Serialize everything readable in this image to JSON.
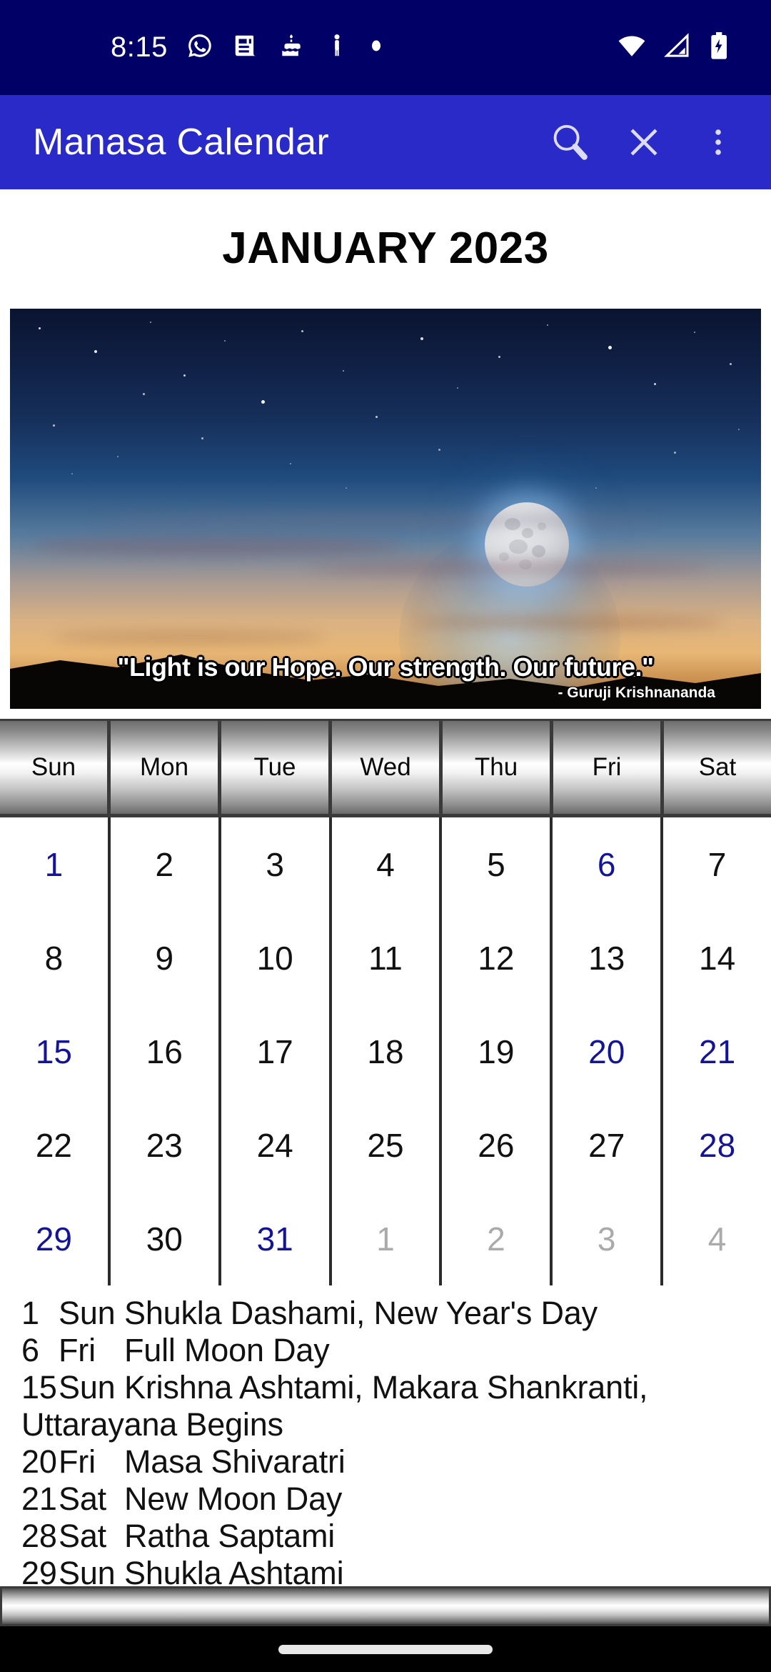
{
  "status_bar": {
    "time": "8:15",
    "left_icons": [
      "whatsapp-icon",
      "news-icon",
      "birthday-cake-icon",
      "person-icon",
      "dot-icon"
    ],
    "right_icons": [
      "wifi-icon",
      "cellular-signal-icon",
      "battery-charging-icon"
    ],
    "background_color": "#000066"
  },
  "app_bar": {
    "title": "Manasa Calendar",
    "background_color": "#2A2AC8",
    "actions": [
      {
        "name": "search-icon",
        "label": "Search"
      },
      {
        "name": "close-icon",
        "label": "Close"
      },
      {
        "name": "overflow-menu-icon",
        "label": "More options"
      }
    ]
  },
  "month_title": "JANUARY 2023",
  "hero": {
    "quote": "\"Light is our Hope. Our strength. Our future.\"",
    "author": "- Guruji Krishnananda",
    "scene": "full-moon-over-twilight-horizon"
  },
  "calendar": {
    "weekday_headers": [
      "Sun",
      "Mon",
      "Tue",
      "Wed",
      "Thu",
      "Fri",
      "Sat"
    ],
    "festival_color": "#141496",
    "normal_color": "#111111",
    "other_month_color": "#aaaaaa",
    "weeks": [
      [
        {
          "day": "1",
          "type": "festival"
        },
        {
          "day": "2",
          "type": "normal"
        },
        {
          "day": "3",
          "type": "normal"
        },
        {
          "day": "4",
          "type": "normal"
        },
        {
          "day": "5",
          "type": "normal"
        },
        {
          "day": "6",
          "type": "festival"
        },
        {
          "day": "7",
          "type": "normal"
        }
      ],
      [
        {
          "day": "8",
          "type": "normal"
        },
        {
          "day": "9",
          "type": "normal"
        },
        {
          "day": "10",
          "type": "normal"
        },
        {
          "day": "11",
          "type": "normal"
        },
        {
          "day": "12",
          "type": "normal"
        },
        {
          "day": "13",
          "type": "normal"
        },
        {
          "day": "14",
          "type": "normal"
        }
      ],
      [
        {
          "day": "15",
          "type": "festival"
        },
        {
          "day": "16",
          "type": "normal"
        },
        {
          "day": "17",
          "type": "normal"
        },
        {
          "day": "18",
          "type": "normal"
        },
        {
          "day": "19",
          "type": "normal"
        },
        {
          "day": "20",
          "type": "festival"
        },
        {
          "day": "21",
          "type": "festival"
        }
      ],
      [
        {
          "day": "22",
          "type": "normal"
        },
        {
          "day": "23",
          "type": "normal"
        },
        {
          "day": "24",
          "type": "normal"
        },
        {
          "day": "25",
          "type": "normal"
        },
        {
          "day": "26",
          "type": "normal"
        },
        {
          "day": "27",
          "type": "normal"
        },
        {
          "day": "28",
          "type": "festival"
        }
      ],
      [
        {
          "day": "29",
          "type": "festival"
        },
        {
          "day": "30",
          "type": "normal"
        },
        {
          "day": "31",
          "type": "festival"
        },
        {
          "day": "1",
          "type": "other"
        },
        {
          "day": "2",
          "type": "other"
        },
        {
          "day": "3",
          "type": "other"
        },
        {
          "day": "4",
          "type": "other"
        }
      ]
    ]
  },
  "events": [
    {
      "day": "1",
      "dow": "Sun",
      "text": "Shukla Dashami, New Year's Day"
    },
    {
      "day": "6",
      "dow": "Fri",
      "text": "Full Moon Day"
    },
    {
      "day": "15",
      "dow": "Sun",
      "text": "Krishna Ashtami, Makara Shankranti, Uttarayana Begins"
    },
    {
      "day": "20",
      "dow": "Fri",
      "text": "Masa Shivaratri"
    },
    {
      "day": "21",
      "dow": "Sat",
      "text": "New Moon Day"
    },
    {
      "day": "28",
      "dow": "Sat",
      "text": "Ratha Saptami"
    },
    {
      "day": "29",
      "dow": "Sun",
      "text": "Shukla Ashtami"
    }
  ],
  "nav_bar": {
    "gesture_pill": "home-gesture-pill"
  }
}
